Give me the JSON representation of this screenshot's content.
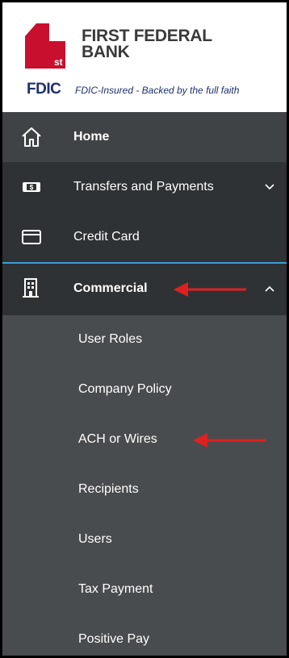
{
  "brand": {
    "line1": "FIRST FEDERAL",
    "line2": "BANK",
    "mark_superscript": "st",
    "mark_color": "#c8102e"
  },
  "fdic": {
    "logo": "FDIC",
    "text": "FDIC-Insured - Backed by the full faith"
  },
  "nav": {
    "home": {
      "label": "Home",
      "icon": "home-icon"
    },
    "transfers": {
      "label": "Transfers and Payments",
      "icon": "dollar-bill-icon",
      "expanded": false
    },
    "credit_card": {
      "label": "Credit Card",
      "icon": "credit-card-icon"
    },
    "commercial": {
      "label": "Commercial",
      "icon": "building-icon",
      "expanded": true
    }
  },
  "submenu": [
    {
      "label": "User Roles"
    },
    {
      "label": "Company Policy"
    },
    {
      "label": "ACH or Wires"
    },
    {
      "label": "Recipients"
    },
    {
      "label": "Users"
    },
    {
      "label": "Tax Payment"
    },
    {
      "label": "Positive Pay"
    }
  ],
  "colors": {
    "accent": "#3a9fd6",
    "annotation_arrow": "#e02020",
    "nav_dark": "#2f3234",
    "nav_mid": "#404345",
    "submenu_bg": "#494c4e"
  }
}
